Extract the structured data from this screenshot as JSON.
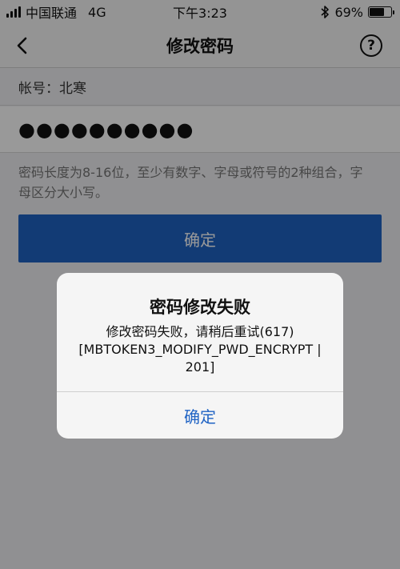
{
  "status_bar": {
    "carrier": "中国联通",
    "network": "4G",
    "time": "下午3:23",
    "bluetooth_icon": "bluetooth-icon",
    "battery_percent": "69%",
    "battery_level": 0.69
  },
  "nav": {
    "title": "修改密码",
    "back_icon": "chevron-left-icon",
    "help_icon": "question-circle-icon",
    "help_glyph": "?"
  },
  "form": {
    "account_label": "帐号：北寒",
    "password_value": "●●●●●●●●●●",
    "hint": "密码长度为8-16位，至少有数字、字母或符号的2种组合，字母区分大小写。",
    "confirm_label": "确定"
  },
  "alert": {
    "title": "密码修改失败",
    "message": "修改密码失败，请稍后重试(617)[MBTOKEN3_MODIFY_PWD_ENCRYPT | 201]",
    "button_label": "确定"
  },
  "colors": {
    "accent": "#1f63c4",
    "overlay": "rgba(0,0,0,0.40)"
  }
}
